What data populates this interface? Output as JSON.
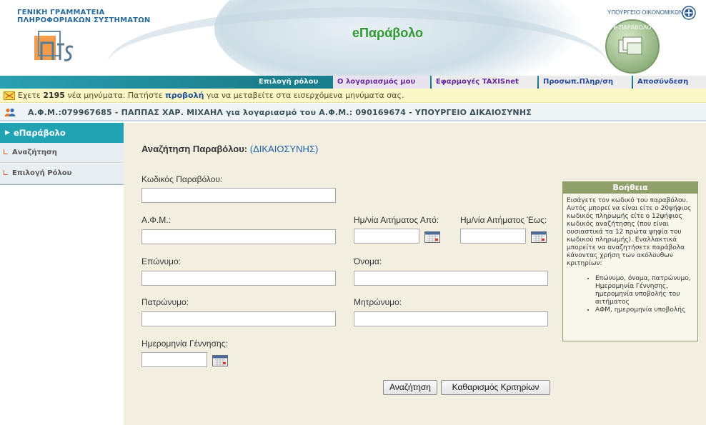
{
  "header": {
    "org_line1": "ΓΕΝΙΚΗ ΓΡΑΜΜΑΤΕΙΑ",
    "org_line2": "ΠΛΗΡΟΦΟΡΙΑΚΩΝ ΣΥΣΤΗΜΑΤΩΝ",
    "app_title": "eΠαράβολο",
    "ministry": "ΥΠΟΥΡΓΕΙΟ ΟΙΚΟΝΟΜΙΚΩΝ"
  },
  "nav": {
    "tabs": [
      {
        "label": "Επιλογή ρόλου"
      },
      {
        "label": "Ο λογαριασμός μου"
      },
      {
        "label": "Εφαρμογές TAXISnet"
      },
      {
        "label": "Προσωπ.Πληρ/ση"
      },
      {
        "label": "Αποσύνδεση"
      }
    ]
  },
  "messages": {
    "prefix": "Εχετε",
    "count": "2195",
    "middle": "νέα μηνύματα. Πατήστε",
    "link": "προβολή",
    "suffix": "για να μεταβείτε στα εισερχόμενα μηνύματα σας."
  },
  "user": {
    "text": "Α.Φ.Μ.:079967685 - ΠΑΠΠΑΣ ΧΑΡ. ΜΙΧΑΗΛ για λογαριασμό του Α.Φ.Μ.: 090169674 - ΥΠΟΥΡΓΕΙΟ ΔΙΚΑΙΟΣΥΝΗΣ"
  },
  "sidebar": {
    "header": "eΠαράβολο",
    "items": [
      {
        "label": "Αναζήτηση"
      },
      {
        "label": "Επιλογή Ρόλου"
      }
    ]
  },
  "form": {
    "title": "Αναζήτηση Παραβόλου:",
    "dept": "(ΔΙΚΑΙΟΣΥΝΗΣ)",
    "code_label": "Κωδικός Παραβόλου:",
    "code_value": "",
    "afm_label": "Α.Φ.Μ.:",
    "afm_value": "",
    "date_from_label": "Ημ/νία Αιτήματος Από:",
    "date_from_value": "",
    "date_to_label": "Ημ/νία Αιτήματος Έως:",
    "date_to_value": "",
    "surname_label": "Επώνυμο:",
    "surname_value": "",
    "name_label": "Όνομα:",
    "name_value": "",
    "father_label": "Πατρώνυμο:",
    "father_value": "",
    "mother_label": "Μητρώνυμο:",
    "mother_value": "",
    "birth_label": "Ημερομηνία Γέννησης:",
    "birth_value": "",
    "search_button": "Αναζήτηση",
    "clear_button": "Καθαρισμός Κριτηρίων"
  },
  "help": {
    "title": "Βοήθεια",
    "text": "Εισάγετε τον κωδικό του παραβόλου. Αυτός μπορεί να είναι είτε ο 20ψήφιος κωδικός πληρωμής είτε ο 12ψήφιος κωδικός αναζήτησης (που είναι ουσιαστικά τα 12 πρώτα ψηφία του κωδικού πληρωμής). Εναλλακτικά μπορείτε να αναζητήσετε παράβολα κάνοντας χρήση των ακόλουθων κριτηρίων:",
    "bullets": [
      "Επώνυμο, όνομα, πατρώνυμο, Ημερομηνία Γέννησης, ημερομηνία υποβολής του αιτήματος",
      "ΑΦΜ, ημερομηνία υποβολής"
    ]
  },
  "colors": {
    "teal": "#22a3b4",
    "title_green": "#2f9a2f",
    "content_bg": "#f3efe0",
    "help_header": "#8fa06a"
  }
}
